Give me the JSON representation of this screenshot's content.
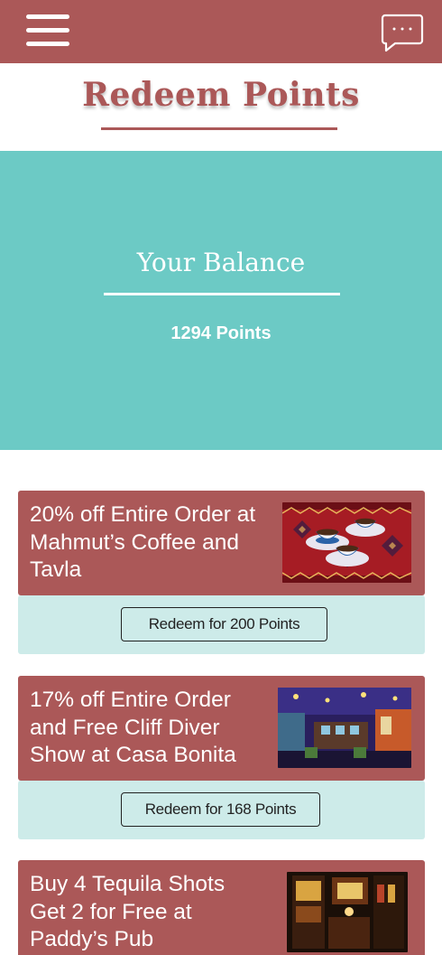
{
  "header": {
    "menu_icon": "hamburger-menu-icon",
    "chat_icon": "chat-bubble-icon",
    "bar_color": "#ab5858"
  },
  "page": {
    "title": "Redeem Points",
    "accent_color": "#ab5858"
  },
  "balance": {
    "label": "Your Balance",
    "points": "1294 Points",
    "background": "#6ccac5"
  },
  "offers": [
    {
      "title": "20% off Entire Order at Mahmut’s Coffee and Tavla",
      "image": "turkish-coffee-cups-image",
      "button": "Redeem for 200 Points"
    },
    {
      "title": "17% off Entire Order and Free Cliff Diver Show at Casa Bonita",
      "image": "restaurant-interior-image",
      "button": "Redeem for 168 Points"
    },
    {
      "title": "Buy 4 Tequila Shots Get 2 for Free at Paddy’s Pub",
      "image": "pub-bar-interior-image"
    }
  ]
}
